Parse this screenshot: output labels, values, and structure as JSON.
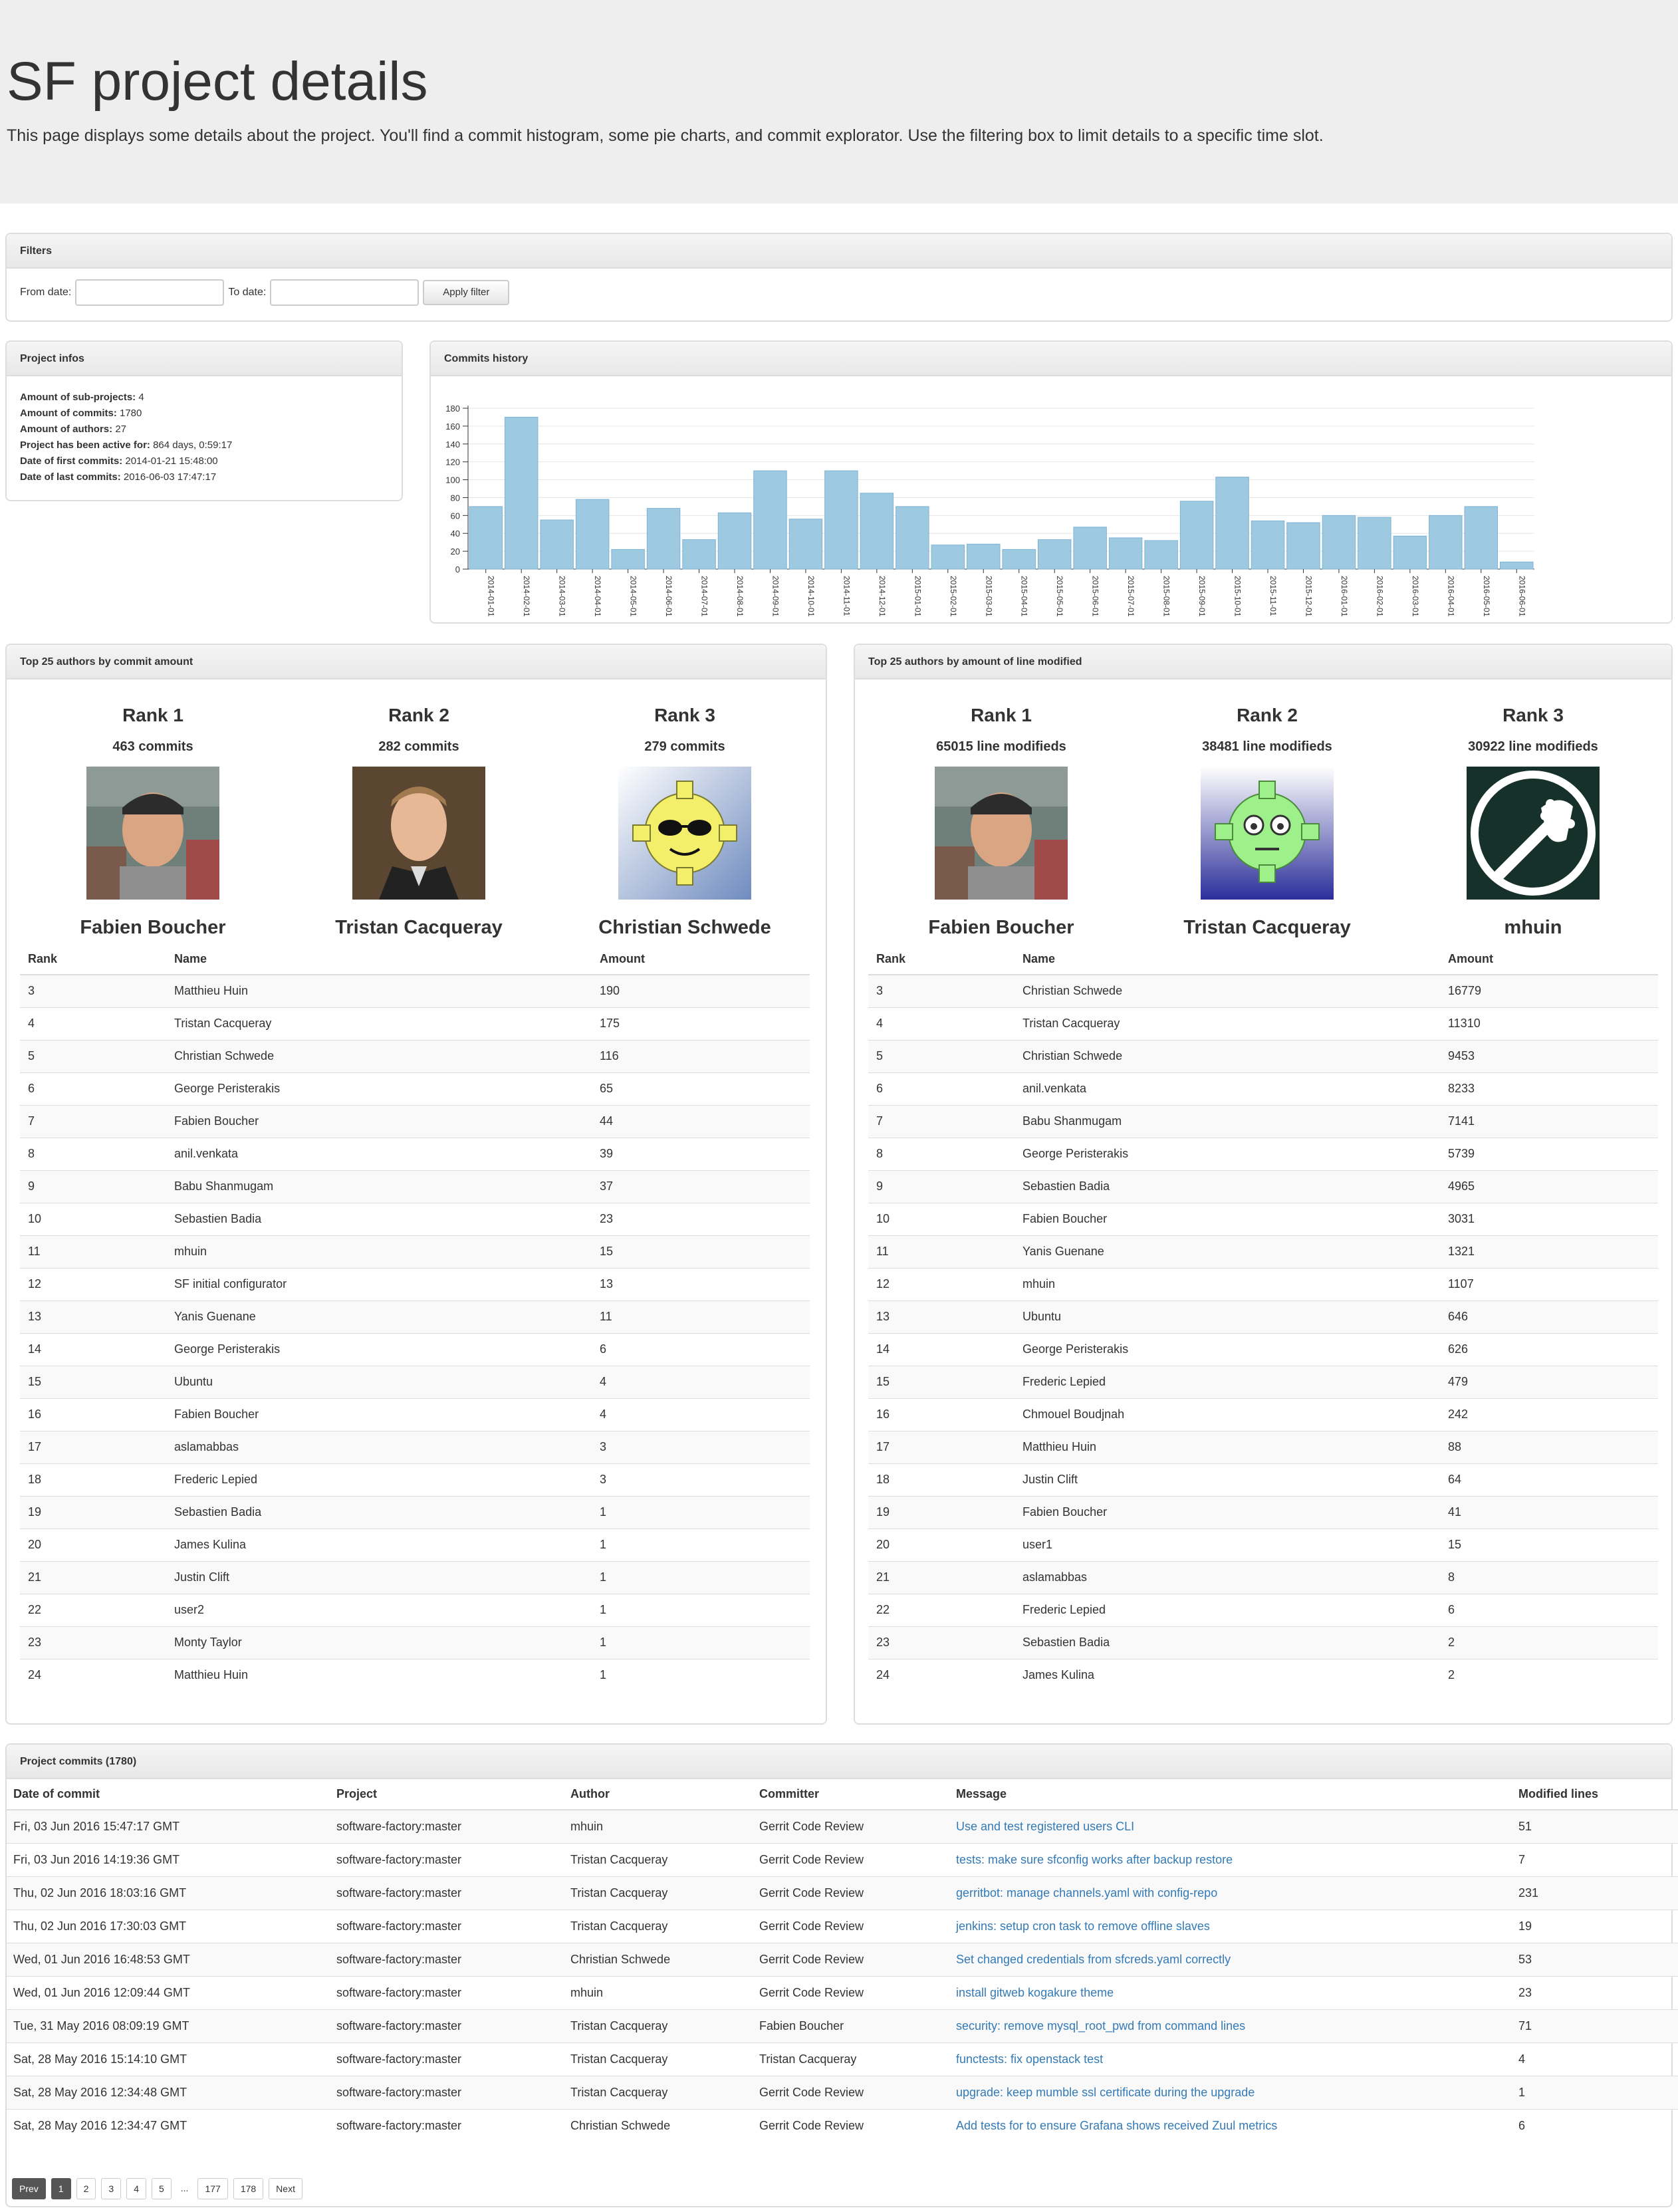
{
  "header": {
    "title": "SF project details",
    "description": "This page displays some details about the project. You'll find a commit histogram, some pie charts, and commit explorator. Use the filtering box to limit details to a specific time slot."
  },
  "filters": {
    "heading": "Filters",
    "from_label": "From date:",
    "to_label": "To date:",
    "from_value": "",
    "to_value": "",
    "apply_label": "Apply filter"
  },
  "infos": {
    "heading": "Project infos",
    "items": [
      {
        "label": "Amount of sub-projects:",
        "value": "4"
      },
      {
        "label": "Amount of commits:",
        "value": "1780"
      },
      {
        "label": "Amount of authors:",
        "value": "27"
      },
      {
        "label": "Project has been active for:",
        "value": "864 days, 0:59:17"
      },
      {
        "label": "Date of first commits:",
        "value": "2014-01-21 15:48:00"
      },
      {
        "label": "Date of last commits:",
        "value": "2016-06-03 17:47:17"
      }
    ]
  },
  "history": {
    "heading": "Commits history"
  },
  "chart_data": {
    "type": "bar",
    "title": "",
    "xlabel": "",
    "ylabel": "",
    "ylim": [
      0,
      180
    ],
    "yticks": [
      0,
      20,
      40,
      60,
      80,
      100,
      120,
      140,
      160,
      180
    ],
    "grid": true,
    "bar_color": "#9ecae1",
    "categories": [
      "2014-01-01",
      "2014-02-01",
      "2014-03-01",
      "2014-04-01",
      "2014-05-01",
      "2014-06-01",
      "2014-07-01",
      "2014-08-01",
      "2014-09-01",
      "2014-10-01",
      "2014-11-01",
      "2014-12-01",
      "2015-01-01",
      "2015-02-01",
      "2015-03-01",
      "2015-04-01",
      "2015-05-01",
      "2015-06-01",
      "2015-07-01",
      "2015-08-01",
      "2015-09-01",
      "2015-10-01",
      "2015-11-01",
      "2015-12-01",
      "2016-01-01",
      "2016-02-01",
      "2016-03-01",
      "2016-04-01",
      "2016-05-01",
      "2016-06-01"
    ],
    "values": [
      70,
      170,
      55,
      78,
      22,
      68,
      33,
      63,
      110,
      56,
      110,
      85,
      70,
      27,
      28,
      22,
      33,
      47,
      35,
      32,
      76,
      103,
      54,
      52,
      60,
      58,
      37,
      60,
      70,
      8
    ]
  },
  "top_commits": {
    "heading": "Top 25 authors by commit amount",
    "podium": [
      {
        "rank": "Rank 1",
        "count": "463 commits",
        "name": "Fabien Boucher",
        "avatar": "photo-avatar"
      },
      {
        "rank": "Rank 2",
        "count": "282 commits",
        "name": "Tristan Cacqueray",
        "avatar": "photo-avatar"
      },
      {
        "rank": "Rank 3",
        "count": "279 commits",
        "name": "Christian Schwede",
        "avatar": "gear-sunglasses-icon"
      }
    ],
    "columns": [
      "Rank",
      "Name",
      "Amount"
    ],
    "rows": [
      [
        "3",
        "Matthieu Huin",
        "190"
      ],
      [
        "4",
        "Tristan Cacqueray",
        "175"
      ],
      [
        "5",
        "Christian Schwede",
        "116"
      ],
      [
        "6",
        "George Peristerakis",
        "65"
      ],
      [
        "7",
        "Fabien Boucher",
        "44"
      ],
      [
        "8",
        "anil.venkata",
        "39"
      ],
      [
        "9",
        "Babu Shanmugam",
        "37"
      ],
      [
        "10",
        "Sebastien Badia",
        "23"
      ],
      [
        "11",
        "mhuin",
        "15"
      ],
      [
        "12",
        "SF initial configurator",
        "13"
      ],
      [
        "13",
        "Yanis Guenane",
        "11"
      ],
      [
        "14",
        "George Peristerakis",
        "6"
      ],
      [
        "15",
        "Ubuntu",
        "4"
      ],
      [
        "16",
        "Fabien Boucher",
        "4"
      ],
      [
        "17",
        "aslamabbas",
        "3"
      ],
      [
        "18",
        "Frederic Lepied",
        "3"
      ],
      [
        "19",
        "Sebastien Badia",
        "1"
      ],
      [
        "20",
        "James Kulina",
        "1"
      ],
      [
        "21",
        "Justin Clift",
        "1"
      ],
      [
        "22",
        "user2",
        "1"
      ],
      [
        "23",
        "Monty Taylor",
        "1"
      ],
      [
        "24",
        "Matthieu Huin",
        "1"
      ]
    ]
  },
  "top_lines": {
    "heading": "Top 25 authors by amount of line modified",
    "podium": [
      {
        "rank": "Rank 1",
        "count": "65015 line modifieds",
        "name": "Fabien Boucher",
        "avatar": "photo-avatar"
      },
      {
        "rank": "Rank 2",
        "count": "38481 line modifieds",
        "name": "Tristan Cacqueray",
        "avatar": "gear-robot-icon"
      },
      {
        "rank": "Rank 3",
        "count": "30922 line modifieds",
        "name": "mhuin",
        "avatar": "guitar-headstock-icon"
      }
    ],
    "columns": [
      "Rank",
      "Name",
      "Amount"
    ],
    "rows": [
      [
        "3",
        "Christian Schwede",
        "16779"
      ],
      [
        "4",
        "Tristan Cacqueray",
        "11310"
      ],
      [
        "5",
        "Christian Schwede",
        "9453"
      ],
      [
        "6",
        "anil.venkata",
        "8233"
      ],
      [
        "7",
        "Babu Shanmugam",
        "7141"
      ],
      [
        "8",
        "George Peristerakis",
        "5739"
      ],
      [
        "9",
        "Sebastien Badia",
        "4965"
      ],
      [
        "10",
        "Fabien Boucher",
        "3031"
      ],
      [
        "11",
        "Yanis Guenane",
        "1321"
      ],
      [
        "12",
        "mhuin",
        "1107"
      ],
      [
        "13",
        "Ubuntu",
        "646"
      ],
      [
        "14",
        "George Peristerakis",
        "626"
      ],
      [
        "15",
        "Frederic Lepied",
        "479"
      ],
      [
        "16",
        "Chmouel Boudjnah",
        "242"
      ],
      [
        "17",
        "Matthieu Huin",
        "88"
      ],
      [
        "18",
        "Justin Clift",
        "64"
      ],
      [
        "19",
        "Fabien Boucher",
        "41"
      ],
      [
        "20",
        "user1",
        "15"
      ],
      [
        "21",
        "aslamabbas",
        "8"
      ],
      [
        "22",
        "Frederic Lepied",
        "6"
      ],
      [
        "23",
        "Sebastien Badia",
        "2"
      ],
      [
        "24",
        "James Kulina",
        "2"
      ]
    ]
  },
  "commits": {
    "heading": "Project commits (1780)",
    "columns": [
      "Date of commit",
      "Project",
      "Author",
      "Committer",
      "Message",
      "Modified lines"
    ],
    "rows": [
      [
        "Fri, 03 Jun 2016 15:47:17 GMT",
        "software-factory:master",
        "mhuin",
        "Gerrit Code Review",
        "Use and test registered users CLI",
        "51"
      ],
      [
        "Fri, 03 Jun 2016 14:19:36 GMT",
        "software-factory:master",
        "Tristan Cacqueray",
        "Gerrit Code Review",
        "tests: make sure sfconfig works after backup restore",
        "7"
      ],
      [
        "Thu, 02 Jun 2016 18:03:16 GMT",
        "software-factory:master",
        "Tristan Cacqueray",
        "Gerrit Code Review",
        "gerritbot: manage channels.yaml with config-repo",
        "231"
      ],
      [
        "Thu, 02 Jun 2016 17:30:03 GMT",
        "software-factory:master",
        "Tristan Cacqueray",
        "Gerrit Code Review",
        "jenkins: setup cron task to remove offline slaves",
        "19"
      ],
      [
        "Wed, 01 Jun 2016 16:48:53 GMT",
        "software-factory:master",
        "Christian Schwede",
        "Gerrit Code Review",
        "Set changed credentials from sfcreds.yaml correctly",
        "53"
      ],
      [
        "Wed, 01 Jun 2016 12:09:44 GMT",
        "software-factory:master",
        "mhuin",
        "Gerrit Code Review",
        "install gitweb kogakure theme",
        "23"
      ],
      [
        "Tue, 31 May 2016 08:09:19 GMT",
        "software-factory:master",
        "Tristan Cacqueray",
        "Fabien Boucher",
        "security: remove mysql_root_pwd from command lines",
        "71"
      ],
      [
        "Sat, 28 May 2016 15:14:10 GMT",
        "software-factory:master",
        "Tristan Cacqueray",
        "Tristan Cacqueray",
        "functests: fix openstack test",
        "4"
      ],
      [
        "Sat, 28 May 2016 12:34:48 GMT",
        "software-factory:master",
        "Tristan Cacqueray",
        "Gerrit Code Review",
        "upgrade: keep mumble ssl certificate during the upgrade",
        "1"
      ],
      [
        "Sat, 28 May 2016 12:34:47 GMT",
        "software-factory:master",
        "Christian Schwede",
        "Gerrit Code Review",
        "Add tests for to ensure Grafana shows received Zuul metrics",
        "6"
      ]
    ]
  },
  "pagination": {
    "prev": "Prev",
    "next": "Next",
    "ellipsis": "...",
    "pages": [
      "1",
      "2",
      "3",
      "4",
      "5"
    ],
    "tail_pages": [
      "177",
      "178"
    ],
    "current": "1"
  }
}
